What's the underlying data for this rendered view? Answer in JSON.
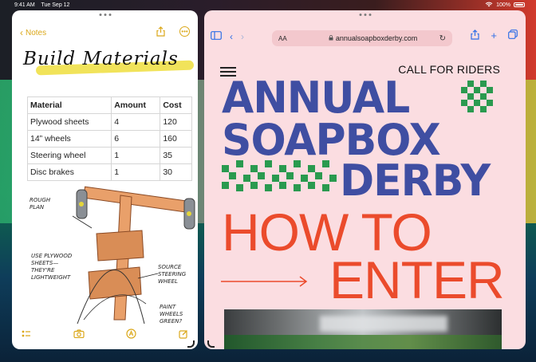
{
  "status_bar": {
    "time": "9:41 AM",
    "date": "Tue Sep 12",
    "battery": "100%"
  },
  "notes": {
    "back_label": "Notes",
    "title": "Build Materials",
    "table": {
      "headers": [
        "Material",
        "Amount",
        "Cost"
      ],
      "rows": [
        [
          "Plywood sheets",
          "4",
          "120"
        ],
        [
          "14” wheels",
          "6",
          "160"
        ],
        [
          "Steering wheel",
          "1",
          "35"
        ],
        [
          "Disc brakes",
          "1",
          "30"
        ]
      ]
    },
    "sketch_labels": {
      "rough_plan": "ROUGH PLAN",
      "plywood": "USE PLYWOOD SHEETS—THEY'RE LIGHTWEIGHT",
      "steering": "SOURCE STEERING WHEEL",
      "paint": "PAINT WHEELS GREEN?"
    }
  },
  "safari": {
    "reader_label": "AA",
    "url": "annualsoapboxderby.com",
    "site": {
      "cta": "CALL FOR RIDERS",
      "headline_1": "ANNUAL",
      "headline_2": "SOAPBOX",
      "headline_3": "DERBY",
      "subhead_1": "HOW TO",
      "subhead_2": "ENTER"
    }
  },
  "colors": {
    "notes_accent": "#dba81a",
    "safari_accent": "#2f6fe6",
    "site_bg": "#fbdde1",
    "site_blue": "#3f4ea2",
    "site_orange": "#eb4b2c",
    "site_green": "#2a9a4f"
  }
}
